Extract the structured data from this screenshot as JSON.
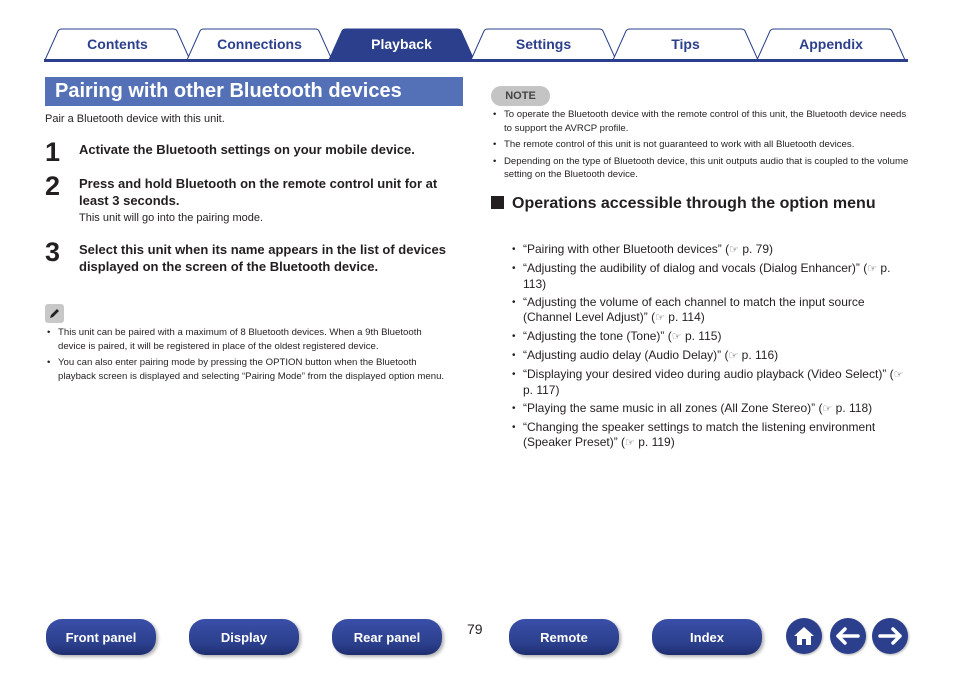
{
  "tabs": [
    {
      "label": "Contents",
      "active": false
    },
    {
      "label": "Connections",
      "active": false
    },
    {
      "label": "Playback",
      "active": true
    },
    {
      "label": "Settings",
      "active": false
    },
    {
      "label": "Tips",
      "active": false
    },
    {
      "label": "Appendix",
      "active": false
    }
  ],
  "section": {
    "title": "Pairing with other Bluetooth devices",
    "intro": "Pair a Bluetooth device with this unit.",
    "steps": [
      {
        "number": "1",
        "text": "Activate the Bluetooth settings on your mobile device.",
        "sub": ""
      },
      {
        "number": "2",
        "text": "Press and hold Bluetooth on the remote control unit for at least 3 seconds.",
        "sub": "This unit will go into the pairing mode."
      },
      {
        "number": "3",
        "text": "Select this unit when its name appears in the list of devices displayed on the screen of the Bluetooth device.",
        "sub": ""
      }
    ],
    "tips": [
      "This unit can be paired with a maximum of 8 Bluetooth devices. When a 9th Bluetooth device is paired, it will be registered in place of the oldest registered device.",
      "You can also enter pairing mode by pressing the OPTION button when the Bluetooth playback screen is displayed and selecting “Pairing Mode” from the displayed option menu."
    ]
  },
  "note": {
    "label": "NOTE",
    "items": [
      "To operate the Bluetooth device with the remote control of this unit, the Bluetooth device needs to support the AVRCP profile.",
      "The remote control of this unit is not guaranteed to work with all Bluetooth devices.",
      "Depending on the type of Bluetooth device, this unit outputs audio that is coupled to the volume setting on the Bluetooth device."
    ]
  },
  "operations": {
    "heading": "Operations accessible through the option menu",
    "ref_icon": "pointing-hand-icon",
    "items": [
      {
        "text": "“Pairing with other Bluetooth devices” (",
        "page": "p. 79)"
      },
      {
        "text": "“Adjusting the audibility of dialog and vocals (Dialog Enhancer)” (",
        "page": "p. 113)"
      },
      {
        "text": "“Adjusting the volume of each channel to match the input source (Channel Level Adjust)” (",
        "page": "p. 114)"
      },
      {
        "text": "“Adjusting the tone (Tone)” (",
        "page": "p. 115)"
      },
      {
        "text": "“Adjusting audio delay (Audio Delay)” (",
        "page": "p. 116)"
      },
      {
        "text": "“Displaying your desired video during audio playback (Video Select)” (",
        "page": "p. 117)"
      },
      {
        "text": "“Playing the same music in all zones (All Zone Stereo)” (",
        "page": "p. 118)"
      },
      {
        "text": "“Changing the speaker settings to match the listening environment (Speaker Preset)” (",
        "page": "p. 119)"
      }
    ]
  },
  "footer": {
    "buttons": [
      "Front panel",
      "Display",
      "Rear panel",
      "Remote",
      "Index"
    ],
    "page_number": "79",
    "icons": [
      "home-icon",
      "back-arrow-icon",
      "forward-arrow-icon"
    ]
  },
  "colors": {
    "brand": "#2b3f8c",
    "title_bar": "#5470b6",
    "note_pill": "#c4c4c4"
  }
}
